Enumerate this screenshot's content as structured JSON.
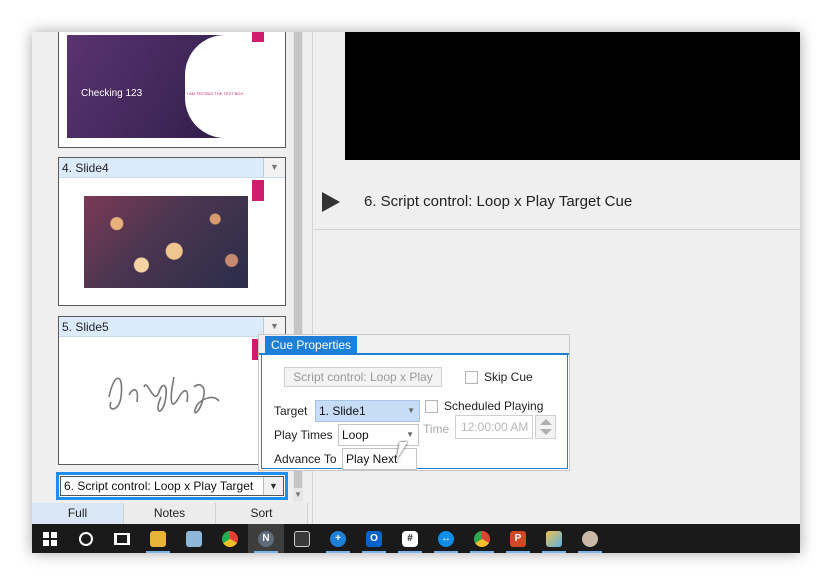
{
  "slide_panel": {
    "slides": [
      {
        "title_text": "Checking 123",
        "subtitle_text": "I AM TESTING THE TEXT BOX"
      },
      {
        "header": "4. Slide4"
      },
      {
        "header": "5. Slide5"
      }
    ],
    "current_cue": "6. Script control: Loop x Play Target",
    "tabs": [
      "Full",
      "Notes",
      "Sort"
    ]
  },
  "main": {
    "cue_title": "6. Script control: Loop x Play Target Cue"
  },
  "cue_properties": {
    "tab_label": "Cue Properties",
    "script_button": "Script control: Loop x Play",
    "skip_cue_label": "Skip Cue",
    "scheduled_playing_label": "Scheduled Playing",
    "target_label": "Target",
    "target_value": "1. Slide1",
    "play_times_label": "Play Times",
    "play_times_value": "Loop",
    "advance_to_label": "Advance To",
    "advance_to_value": "Play Next",
    "time_label": "Time",
    "time_value": "12:00:00 AM"
  },
  "taskbar": {
    "icons": [
      "windows-start",
      "cortana",
      "task-view",
      "file-explorer",
      "notepad",
      "chrome",
      "presentation-app",
      "calculator",
      "app-blue",
      "outlook",
      "app-slack",
      "teamviewer",
      "chrome",
      "powerpoint",
      "paint",
      "app-other"
    ]
  },
  "colors": {
    "accent_blue": "#1e7fd8",
    "slide_accent": "#cf1d6b",
    "header_blue": "#dcebfb"
  }
}
